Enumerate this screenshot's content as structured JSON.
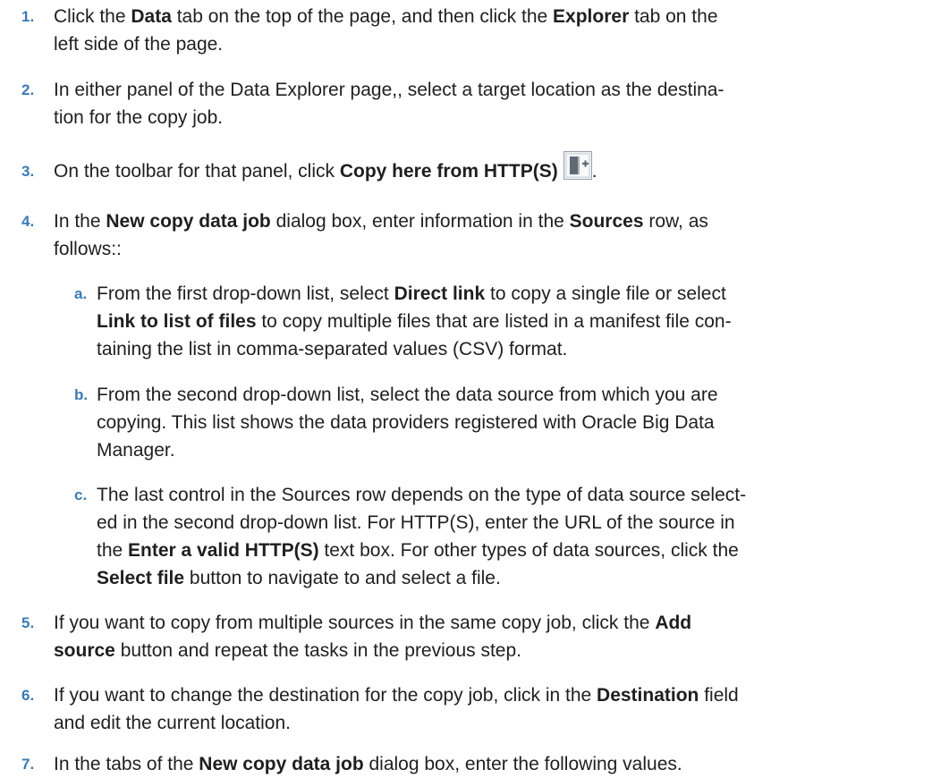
{
  "steps": [
    {
      "number": "1.",
      "lines": [
        [
          "Click the ",
          "Data",
          " tab on the top of the page, and then click the ",
          "Explorer",
          " tab on the"
        ],
        [
          "left side of the page."
        ]
      ]
    },
    {
      "number": "2.",
      "lines": [
        [
          "In either panel of the Data Explorer page,, select a target location as the destina-"
        ],
        [
          "tion for the copy job."
        ]
      ]
    },
    {
      "number": "3.",
      "lines": [
        [
          "On the toolbar for that panel, click ",
          "Copy here from HTTP(S)",
          "",
          "."
        ]
      ],
      "icon": "copy-here-from-http-icon"
    },
    {
      "number": "4.",
      "lines": [
        [
          "In the ",
          "New copy data job",
          " dialog box, enter information in the ",
          "Sources",
          " row, as"
        ],
        [
          "follows::"
        ]
      ]
    },
    {
      "number": "a.",
      "lines": [
        [
          "From the first drop-down list, select ",
          "Direct link",
          " to copy a single file or select"
        ],
        [
          "",
          "Link to list of files",
          " to copy multiple files that are listed in a manifest file con-"
        ],
        [
          "taining the list in comma-separated values (CSV) format."
        ]
      ]
    },
    {
      "number": "b.",
      "lines": [
        [
          "From the second drop-down list, select the data source from which you are"
        ],
        [
          "copying. This list shows the data providers registered with Oracle Big Data"
        ],
        [
          "Manager."
        ]
      ]
    },
    {
      "number": "c.",
      "lines": [
        [
          "The last control in the Sources row depends on the type of data source select-"
        ],
        [
          "ed in the second drop-down list. For HTTP(S), enter the URL of the source in"
        ],
        [
          "the ",
          "Enter a valid HTTP(S)",
          " text box. For other types of data sources, click the"
        ],
        [
          "",
          "Select file",
          " button to navigate to and select a file."
        ]
      ]
    },
    {
      "number": "5.",
      "lines": [
        [
          "If you want to copy from multiple sources in the same copy job, click the ",
          "Add"
        ],
        [
          "",
          "source",
          " button and repeat the tasks in the previous step."
        ]
      ]
    },
    {
      "number": "6.",
      "lines": [
        [
          "If you want to change the destination for the copy job, click in the ",
          "Destination",
          " field"
        ],
        [
          "and edit the current location."
        ]
      ]
    },
    {
      "number": "7.",
      "lines": [
        [
          "In the tabs of the ",
          "New copy data job",
          " dialog box, enter the following values."
        ]
      ]
    }
  ]
}
